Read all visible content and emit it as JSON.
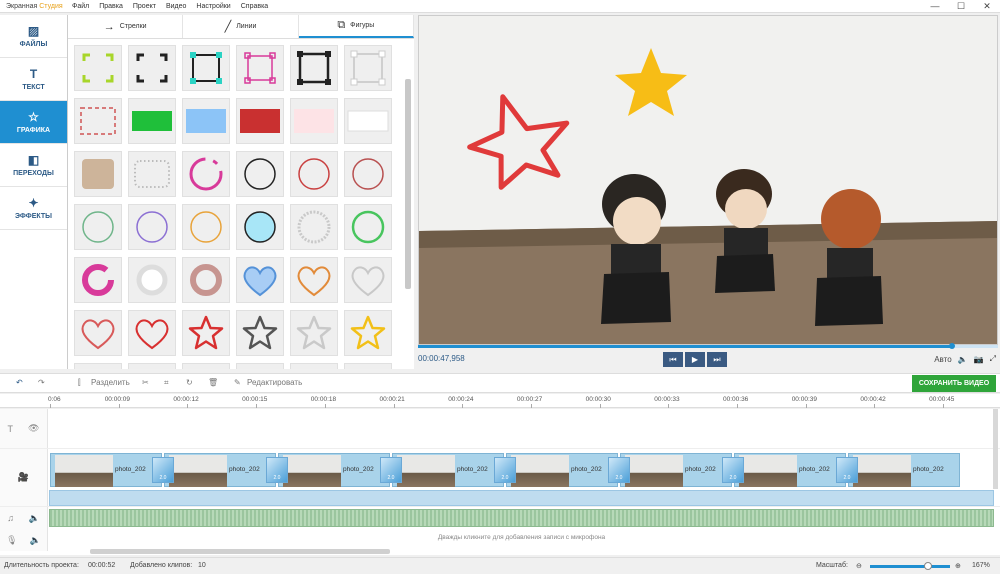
{
  "app": {
    "title_main": "Экранная ",
    "title_accent": "Студия"
  },
  "menu": [
    "Файл",
    "Правка",
    "Проект",
    "Видео",
    "Настройки",
    "Справка"
  ],
  "window_controls": [
    "—",
    "☐",
    "✕"
  ],
  "nav": [
    {
      "label": "ФАЙЛЫ",
      "icon": "image-icon"
    },
    {
      "label": "ТЕКСТ",
      "icon": "text-icon"
    },
    {
      "label": "ГРАФИКА",
      "icon": "star-icon",
      "active": true
    },
    {
      "label": "ПЕРЕХОДЫ",
      "icon": "transitions-icon"
    },
    {
      "label": "ЭФФЕКТЫ",
      "icon": "magic-wand-icon"
    }
  ],
  "tabs": [
    {
      "label": "Стрелки",
      "icon": "arrow-icon"
    },
    {
      "label": "Линии",
      "icon": "line-icon"
    },
    {
      "label": "Фигуры",
      "icon": "shapes-icon",
      "active": true
    }
  ],
  "shapes_colors": {
    "lime": "#a8d62a",
    "black": "#222222",
    "cyan": "#2ad3c4",
    "magenta": "#d83a9a",
    "green": "#1fbf3a",
    "lightblue": "#8cc4f7",
    "red": "#c93030",
    "pink": "#fde3e6",
    "gold": "#f2c018",
    "purple": "#8b6fd3",
    "orange": "#e8a33a",
    "beige": "#cdb49a"
  },
  "player": {
    "timecode": "00:00:47,958",
    "progress": 0.92,
    "quality": "Авто"
  },
  "toolbar": {
    "split": "Разделить",
    "edit": "Редактировать",
    "save": "СОХРАНИТЬ ВИДЕО"
  },
  "ruler": [
    "0:06",
    "00:00:09",
    "00:00:12",
    "00:00:15",
    "00:00:18",
    "00:00:21",
    "00:00:24",
    "00:00:27",
    "00:00:30",
    "00:00:33",
    "00:00:36",
    "00:00:39",
    "00:00:42",
    "00:00:45"
  ],
  "clips": [
    "photo_202",
    "photo_202",
    "photo_202",
    "photo_202",
    "photo_202",
    "photo_202",
    "photo_202",
    "photo_202"
  ],
  "transition_label": "2.0",
  "mic_hint": "Дважды кликните для добавления записи с микрофона",
  "status": {
    "duration_label": "Длительность проекта:",
    "duration": "00:00:52",
    "clips_label": "Добавлено клипов:",
    "clips": "10",
    "scale_label": "Масштаб:",
    "zoom": "167%",
    "zoom_level": 0.72
  }
}
